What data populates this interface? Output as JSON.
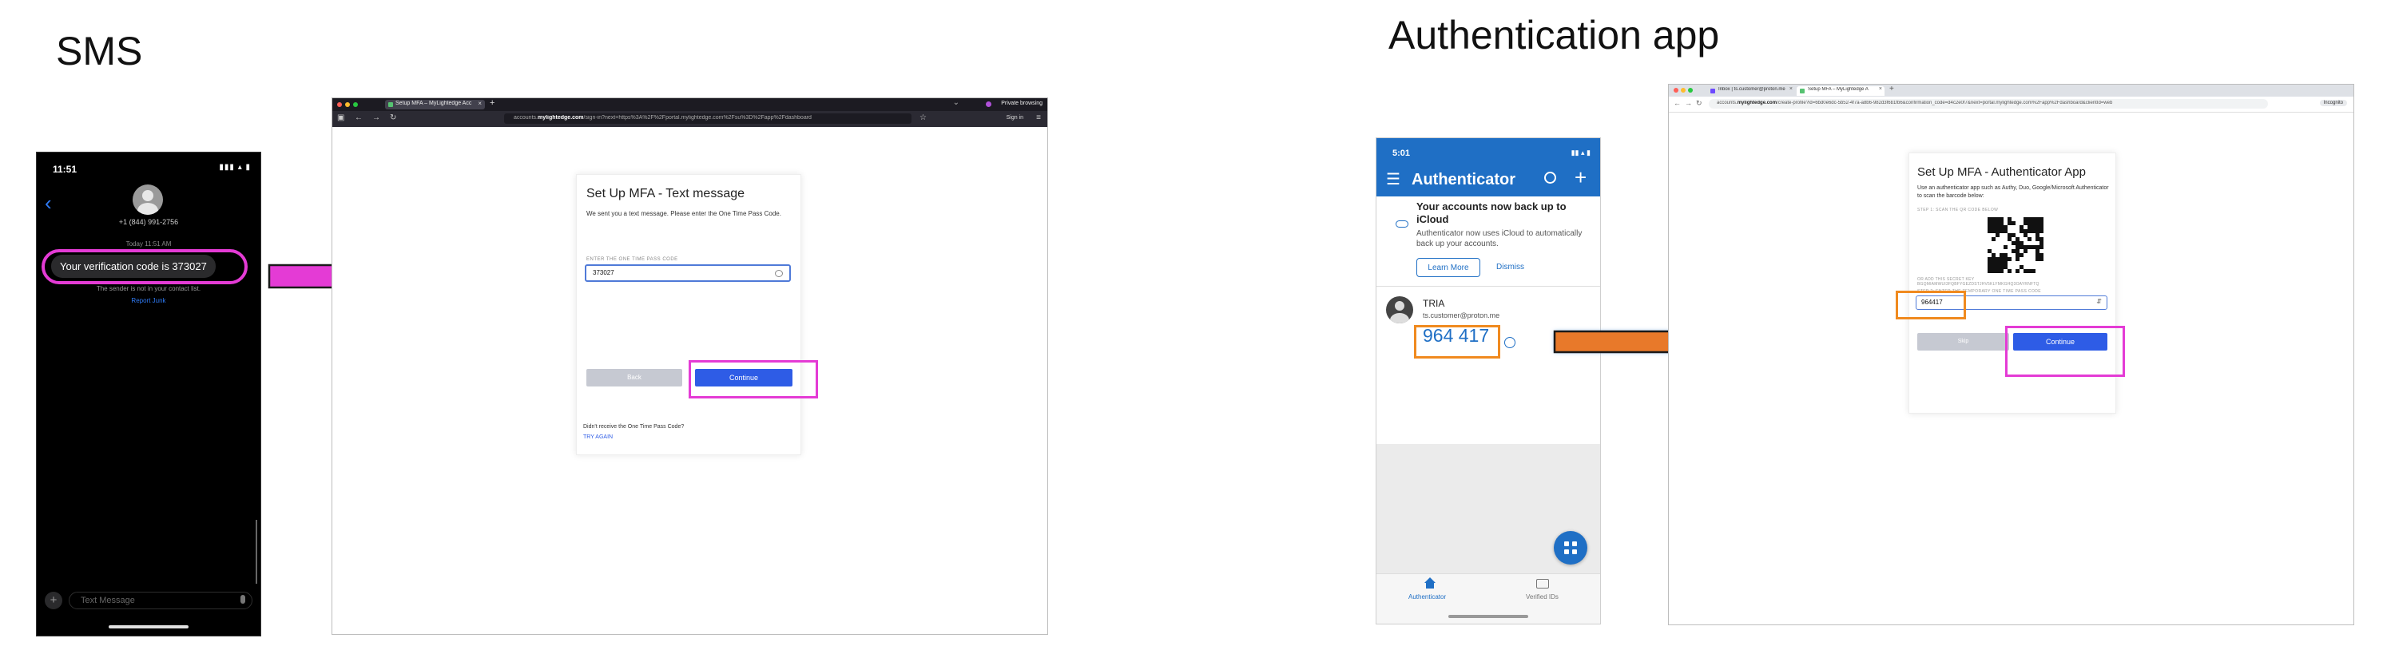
{
  "headings": {
    "sms": "SMS",
    "auth": "Authentication app"
  },
  "sms_phone": {
    "time": "11:51",
    "status_icons": "▮▮▮ ▴ ▮",
    "sender_number": "+1 (844) 991-2756",
    "timestamp": "Today 11:51 AM",
    "message": "Your verification code is 373027",
    "unknown_sender_notice": "The sender is not in your contact list.",
    "report_link": "Report Junk",
    "input_placeholder": "Text Message"
  },
  "browser_sms": {
    "tab_title": "Setup MFA – MyLightedge Acc",
    "private_label": "Private browsing",
    "url_prefix": "accounts.",
    "url_domain": "mylightedge.com",
    "url_rest": "/sign-in?next=https%3A%2F%2Fportal.mylightedge.com%2Fsu%3D%2Fapp%2Fdashboard",
    "sign_in": "Sign in",
    "card": {
      "title": "Set Up MFA - Text message",
      "description": "We sent you a text message. Please enter the One Time Pass Code.",
      "field_label": "ENTER THE ONE TIME PASS CODE",
      "field_value": "373027",
      "back_label": "Back",
      "continue_label": "Continue",
      "resend_question": "Didn't receive the One Time Pass Code?",
      "try_again": "TRY AGAIN"
    }
  },
  "auth_phone": {
    "time": "5:01",
    "status_icons": "▮▮ ▴ ▮",
    "app_title": "Authenticator",
    "backup_title": "Your accounts now back up to iCloud",
    "backup_desc": "Authenticator now uses iCloud to automatically back up your accounts.",
    "learn_more": "Learn More",
    "dismiss": "Dismiss",
    "account_name": "TRIA",
    "account_email": "ts.customer@proton.me",
    "code": "964 417",
    "tab_authenticator": "Authenticator",
    "tab_verified": "Verified IDs"
  },
  "browser_auth": {
    "tab1_title": "Inbox | ts.customer@proton.me",
    "tab2_title": "Setup MFA – MyLightedge A",
    "url_prefix": "accounts.",
    "url_domain": "mylightedge.com",
    "url_rest": "/create-profile?id=6bd0e6dc-5b52-4f7a-a8b6-982d3f6b1fb6&confirmation_code=d4c2e0f7&next=portal.mylightedge.com%2Fapp%2Fdashboard&clientId=web",
    "incognito": "Incognito",
    "card": {
      "title": "Set Up MFA - Authenticator App",
      "description": "Use an authenticator app such as Authy, Duo, Google/Microsoft Authenticator to scan the barcode below:",
      "step1": "STEP 1: SCAN THE QR CODE BELOW",
      "manual": "OR ADD THIS SECRET KEY",
      "secret": "BGQMIAMWUI3FQBFYGEZDSTJHV5KLYMKGHQ3OAYRNFTQ",
      "step2": "STEP 2: ENTER THE TEMPORARY ONE TIME PASS CODE",
      "field_value": "964417",
      "skip_label": "Skip",
      "continue_label": "Continue"
    }
  },
  "colors": {
    "sms_highlight": "#e43bd5",
    "auth_highlight": "#f08a1f",
    "primary_button": "#2e5ce6",
    "authenticator_blue": "#1f6fc5"
  }
}
